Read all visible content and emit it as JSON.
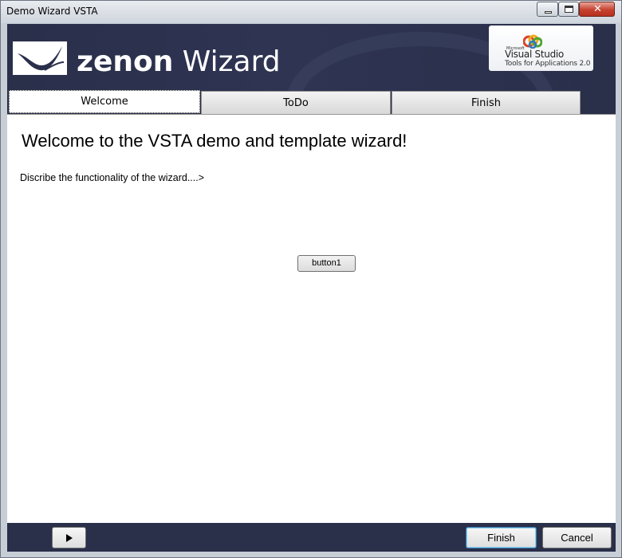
{
  "window": {
    "title": "Demo Wizard VSTA",
    "controls": {
      "minimize": "minimize-icon",
      "maximize": "maximize-icon",
      "close": "close-icon"
    }
  },
  "header": {
    "brand_bold": "zenon",
    "brand_light": " Wizard",
    "vs_badge": {
      "microsoft": "Microsoft",
      "product": "Visual Studio",
      "subtitle": "Tools for Applications 2.0"
    }
  },
  "tabs": [
    {
      "label": "Welcome",
      "selected": true
    },
    {
      "label": "ToDo",
      "selected": false
    },
    {
      "label": "Finish",
      "selected": false
    }
  ],
  "content": {
    "title": "Welcome to the VSTA demo and template wizard!",
    "description": "Discribe the functionality of the wizard....>",
    "button1_label": "button1"
  },
  "footer": {
    "play_icon": "play-icon",
    "finish_label": "Finish",
    "cancel_label": "Cancel"
  },
  "colors": {
    "banner": "#2a2f4a",
    "content_bg": "#ffffff",
    "close_button": "#c6412f"
  }
}
